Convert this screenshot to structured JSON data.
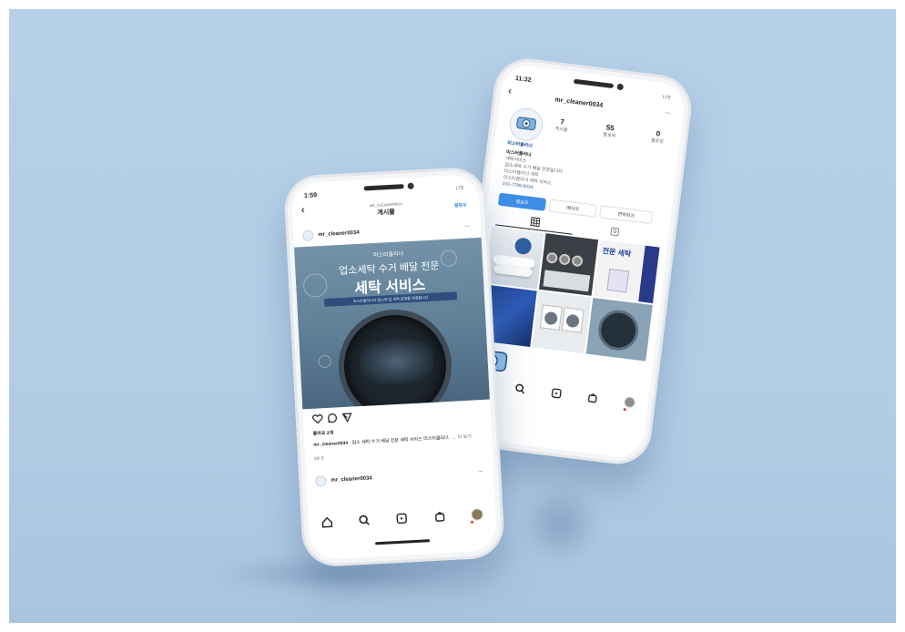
{
  "colors": {
    "background": "#b5cfe8",
    "accent_blue": "#3e8ee8",
    "post_bg": "#6e8ea6",
    "post_dark": "#2c3e4e",
    "text": "#222222"
  },
  "left_phone": {
    "status_time": "1:59",
    "status_right": "LTE",
    "header_small": "MR_CLEANER0034",
    "header_title": "게시물",
    "header_action": "팔로우",
    "post_username": "mr_cleaner0034",
    "post_more": "...",
    "post_brand": "미스터클리너",
    "post_headline": "업소세탁 수거 배달 전문",
    "post_big": "세탁 서비스",
    "post_banner": "미스터클리너가 업소와 집 세탁 문제를 해결합니다",
    "likes": "좋아요 2개",
    "caption_user": "mr_cleaner0034",
    "caption_text": "업소 세탁 수거 배달 전문 세탁 서비스 미스터클리너",
    "caption_more": "... 더 보기",
    "time_ago": "8일 전",
    "next_username": "mr_cleaner0034",
    "next_more": "...",
    "icons": [
      "heart-icon",
      "comment-icon",
      "send-icon"
    ],
    "nav_icons": [
      "home-icon",
      "search-icon",
      "reels-icon",
      "shop-icon",
      "profile-icon"
    ]
  },
  "right_phone": {
    "status_time": "11:32",
    "status_right": "LTE",
    "profile_username": "mr_cleaner0034",
    "profile_more": "...",
    "logo_text": "미스터클리너",
    "stats": [
      {
        "value": "7",
        "label": "게시물"
      },
      {
        "value": "55",
        "label": "팔로워"
      },
      {
        "value": "0",
        "label": "팔로잉"
      }
    ],
    "bio_lines": [
      "미스터클리너",
      "세탁서비스",
      "업소세탁 수거 배달 전문입니다",
      "미스터클리너 세탁",
      "미스터클리너 세탁 서비스",
      "010-7799-0034"
    ],
    "buttons": [
      "팔로우",
      "메시지",
      "연락하기"
    ],
    "grid_tiles": [
      "수건",
      "세탁 장비",
      "전문 세탁",
      "청바지",
      "세탁기",
      "세탁 드럼"
    ],
    "nav_icons": [
      "home-icon",
      "search-icon",
      "reels-icon",
      "shop-icon",
      "profile-icon"
    ]
  }
}
